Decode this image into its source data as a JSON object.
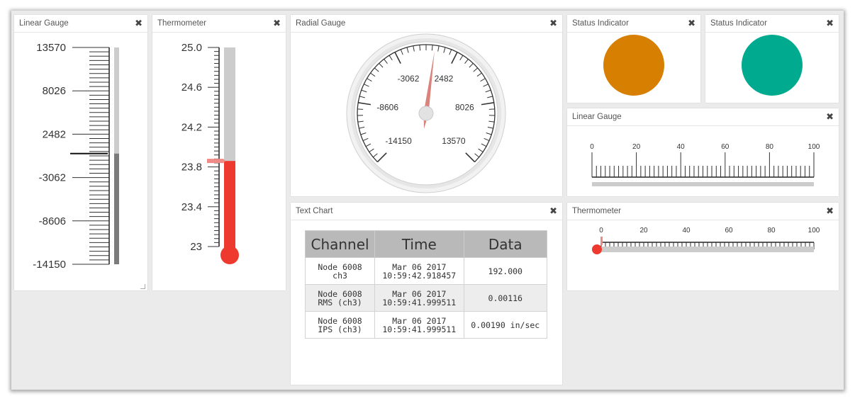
{
  "close_glyph": "✖",
  "panels": {
    "linear_gauge_v": {
      "title": "Linear Gauge",
      "ticks": [
        "13570",
        "8026",
        "2482",
        "-3062",
        "-8606",
        "-14150"
      ],
      "min": -14150,
      "max": 13570,
      "value": 0
    },
    "thermo_v": {
      "title": "Thermometer",
      "ticks": [
        "25.0",
        "24.6",
        "24.2",
        "23.8",
        "23.4",
        "23"
      ],
      "min": 23,
      "max": 25,
      "value": 23.86,
      "fill_color": "#ee3a2e"
    },
    "radial": {
      "title": "Radial Gauge",
      "labels": [
        "-14150",
        "-8606",
        "-3062",
        "2482",
        "8026",
        "13570"
      ],
      "min": -14150,
      "max": 13570,
      "value": 500
    },
    "status1": {
      "title": "Status Indicator",
      "color": "#d67f00"
    },
    "status2": {
      "title": "Status Indicator",
      "color": "#00aa8f"
    },
    "linear_gauge_h": {
      "title": "Linear Gauge",
      "ticks": [
        "0",
        "20",
        "40",
        "60",
        "80",
        "100"
      ],
      "min": 0,
      "max": 100,
      "value": 0
    },
    "textchart": {
      "title": "Text Chart",
      "headers": [
        "Channel",
        "Time",
        "Data"
      ],
      "rows": [
        {
          "channel_1": "Node 6008",
          "channel_2": "ch3",
          "time_1": "Mar 06 2017",
          "time_2": "10:59:42.918457",
          "data": "192.000"
        },
        {
          "channel_1": "Node 6008",
          "channel_2": "RMS (ch3)",
          "time_1": "Mar 06 2017",
          "time_2": "10:59:41.999511",
          "data": "0.00116"
        },
        {
          "channel_1": "Node 6008",
          "channel_2": "IPS (ch3)",
          "time_1": "Mar 06 2017",
          "time_2": "10:59:41.999511",
          "data": "0.00190 in/sec"
        }
      ]
    },
    "thermo_h": {
      "title": "Thermometer",
      "ticks": [
        "0",
        "20",
        "40",
        "60",
        "80",
        "100"
      ],
      "min": 0,
      "max": 100,
      "value": 0,
      "fill_color": "#ee3a2e"
    }
  }
}
